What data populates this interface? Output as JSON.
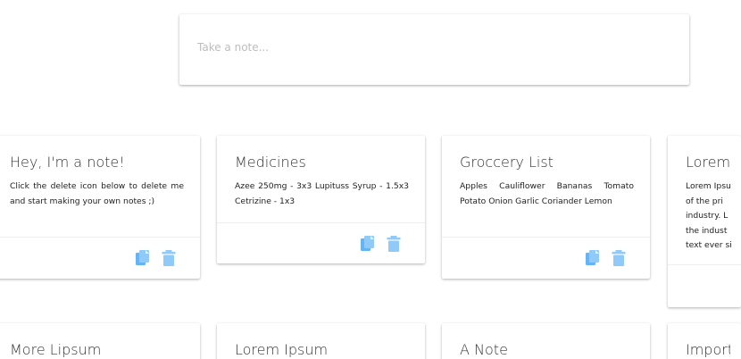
{
  "search": {
    "placeholder": "Take a note..."
  },
  "colors": {
    "icon": "#90caf9",
    "icon_dark": "#64b5f6",
    "divider": "#eeeeee"
  },
  "notes": [
    {
      "title": "Hey, I'm a note!",
      "body": "Click the delete icon below to delete me and start making your own notes ;)",
      "actions": [
        "copy-icon",
        "delete-icon"
      ]
    },
    {
      "title": "Medicines",
      "body": "Azee 250mg - 3x3 Lupituss Syrup - 1.5x3 Cetrizine - 1x3",
      "actions": [
        "copy-icon",
        "delete-icon"
      ]
    },
    {
      "title": "Groccery List",
      "body": "Apples Cauliflower Bananas Tomato Potato Onion Garlic Coriander Lemon",
      "actions": [
        "copy-icon",
        "delete-icon"
      ]
    },
    {
      "title": "Lorem I",
      "body": "Lorem Ipsu of the pri industry. L the indust text ever si"
    },
    {
      "title": "More Lipsum"
    },
    {
      "title": "Lorem Ipsum"
    },
    {
      "title": "A Note"
    },
    {
      "title": "Importa"
    }
  ]
}
